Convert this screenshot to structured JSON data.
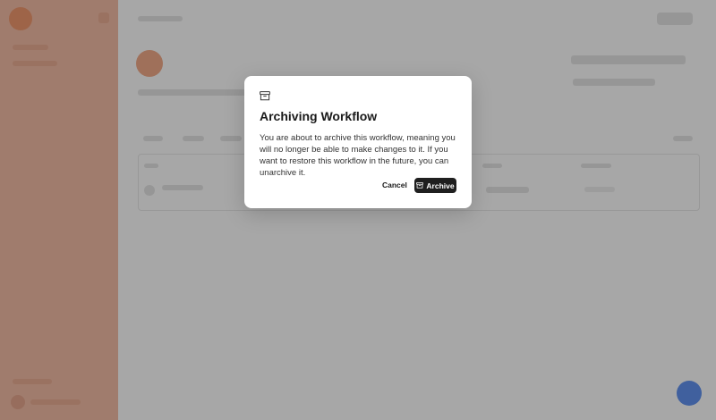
{
  "modal": {
    "icon": "archive-box-icon",
    "title": "Archiving Workflow",
    "body": "You are about to archive this workflow, meaning you will no longer be able to make changes to it. If you want to restore this workflow in the future, you can unarchive it.",
    "cancel_label": "Cancel",
    "archive_label": "Archive",
    "archive_icon": "archive-box-icon"
  },
  "colors": {
    "sidebar_bg": "#f3b59b",
    "brand_accent": "#f08c5c",
    "primary_button": "#1f1f1f",
    "fab": "#4f86f0",
    "overlay": "rgba(45,45,45,0.42)"
  },
  "icons": {
    "logo": "brand-logo-icon",
    "sidebar_collapse": "sidebar-collapse-icon",
    "help_fab": "help-chat-icon"
  }
}
